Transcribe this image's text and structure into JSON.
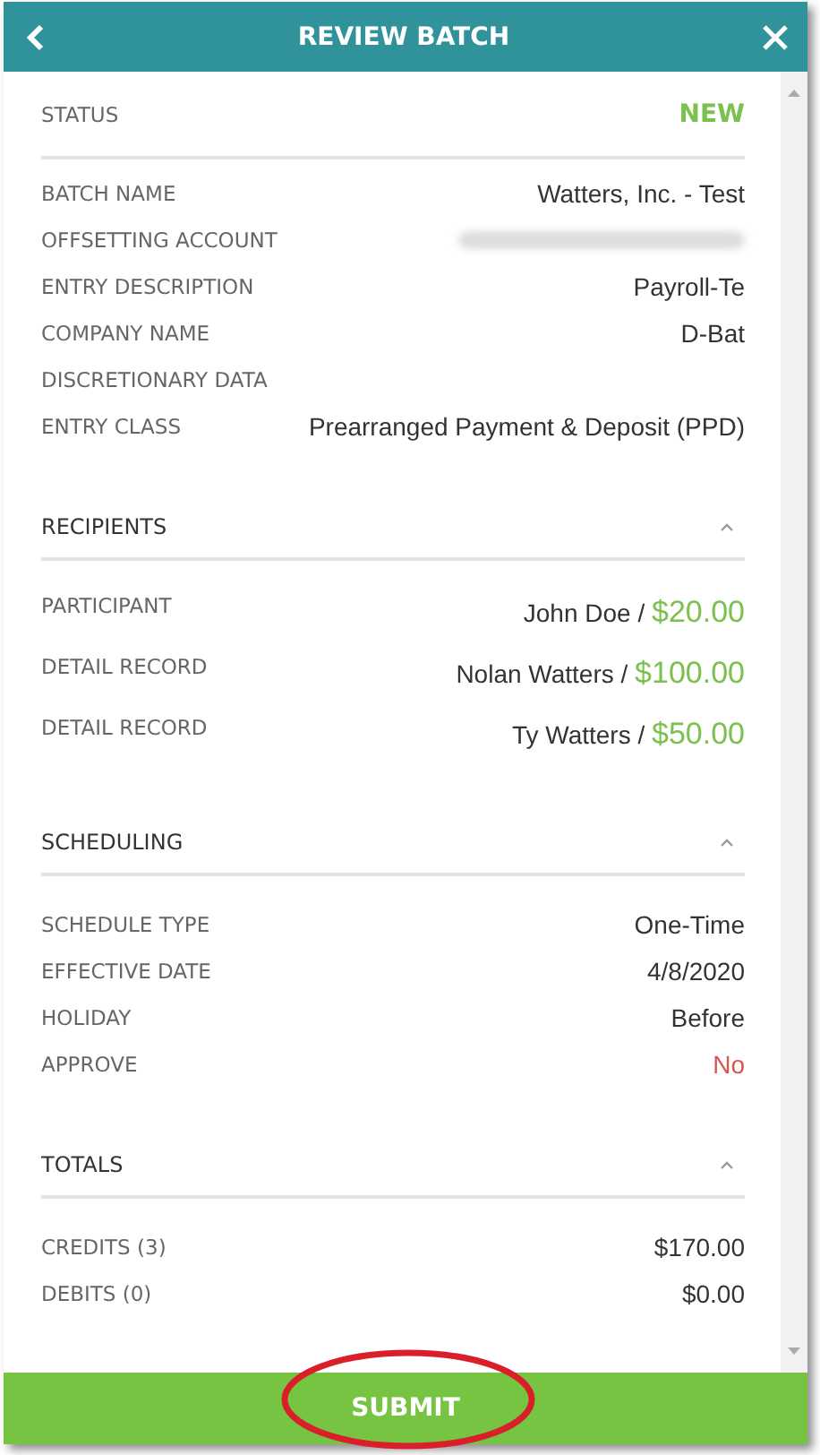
{
  "header": {
    "title": "REVIEW BATCH"
  },
  "status": {
    "label": "STATUS",
    "value": "NEW",
    "color": "#7cc04f"
  },
  "details": [
    {
      "label": "BATCH NAME",
      "value": "Watters, Inc. - Test"
    },
    {
      "label": "OFFSETTING ACCOUNT",
      "redacted": true
    },
    {
      "label": "ENTRY DESCRIPTION",
      "value": "Payroll-Te"
    },
    {
      "label": "COMPANY NAME",
      "value": "D-Bat"
    },
    {
      "label": "DISCRETIONARY DATA"
    },
    {
      "label": "ENTRY CLASS",
      "value": "Prearranged Payment & Deposit (PPD)"
    }
  ],
  "recipients": {
    "title": "RECIPIENTS",
    "expanded": true,
    "rows": [
      {
        "label": "PARTICIPANT",
        "name": "John Doe /",
        "amount": "$20.00"
      },
      {
        "label": "DETAIL RECORD",
        "name": "Nolan Watters /",
        "amount": "$100.00"
      },
      {
        "label": "DETAIL RECORD",
        "name": "Ty Watters /",
        "amount": "$50.00"
      }
    ]
  },
  "scheduling": {
    "title": "SCHEDULING",
    "expanded": true,
    "rows": [
      {
        "label": "SCHEDULE TYPE",
        "value": "One-Time"
      },
      {
        "label": "EFFECTIVE DATE",
        "value": "4/8/2020"
      },
      {
        "label": "HOLIDAY",
        "value": "Before"
      },
      {
        "label": "APPROVE",
        "value": "No",
        "color": "#d9534f"
      }
    ]
  },
  "totals": {
    "title": "TOTALS",
    "expanded": true,
    "rows": [
      {
        "label": "CREDITS (3)",
        "value": "$170.00"
      },
      {
        "label": "DEBITS (0)",
        "value": "$0.00"
      }
    ]
  },
  "submit": {
    "label": "SUBMIT",
    "circled": true
  }
}
